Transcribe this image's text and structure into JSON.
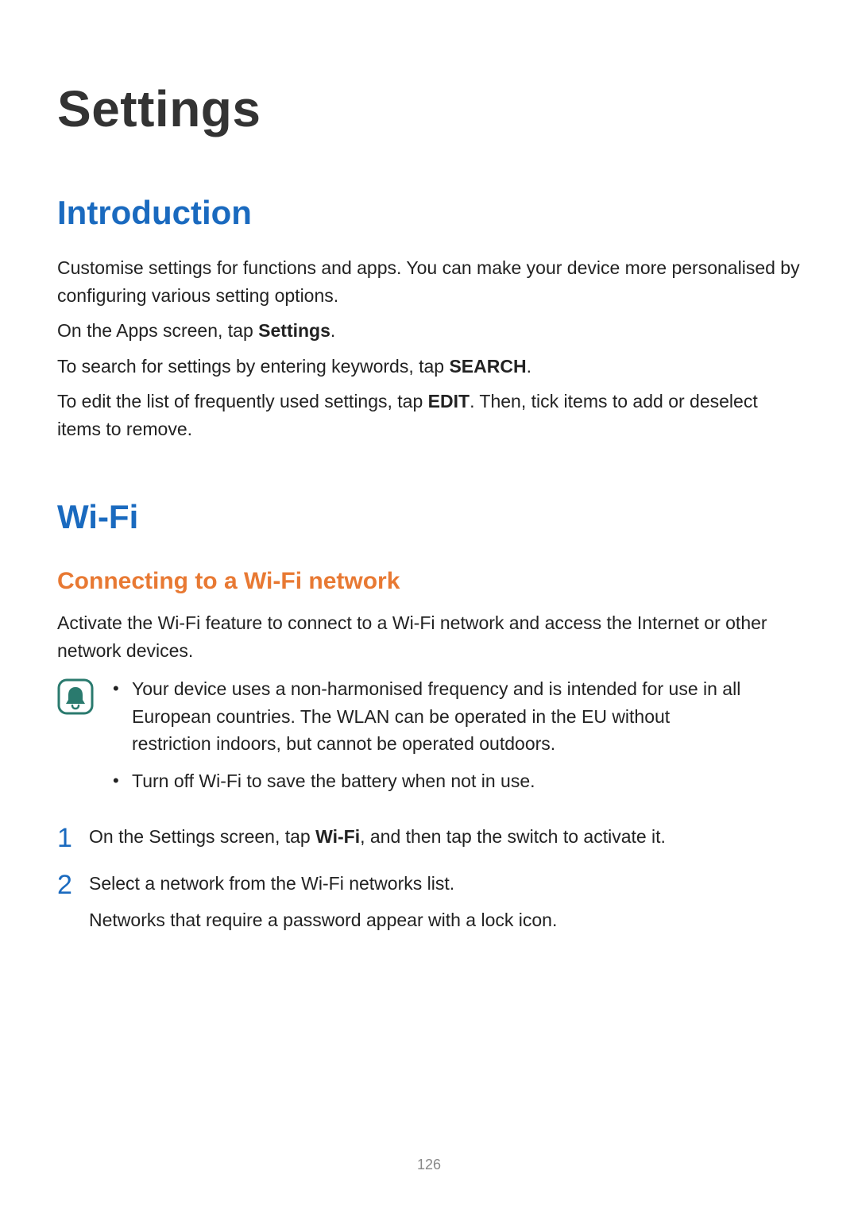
{
  "title": "Settings",
  "pageNumber": "126",
  "introduction": {
    "heading": "Introduction",
    "p1": "Customise settings for functions and apps. You can make your device more personalised by configuring various setting options.",
    "p2_pre": "On the Apps screen, tap ",
    "p2_bold": "Settings",
    "p2_post": ".",
    "p3_pre": "To search for settings by entering keywords, tap ",
    "p3_bold": "SEARCH",
    "p3_post": ".",
    "p4_pre": "To edit the list of frequently used settings, tap ",
    "p4_bold": "EDIT",
    "p4_post": ". Then, tick items to add or deselect items to remove."
  },
  "wifi": {
    "heading": "Wi-Fi",
    "sub1": {
      "heading": "Connecting to a Wi-Fi network",
      "p1": "Activate the Wi-Fi feature to connect to a Wi-Fi network and access the Internet or other network devices.",
      "notes": [
        "Your device uses a non-harmonised frequency and is intended for use in all European countries. The WLAN can be operated in the EU without restriction indoors, but cannot be operated outdoors.",
        "Turn off Wi-Fi to save the battery when not in use."
      ],
      "steps": {
        "s1_pre": "On the Settings screen, tap ",
        "s1_bold": "Wi-Fi",
        "s1_post": ", and then tap the switch to activate it.",
        "s2_main": "Select a network from the Wi-Fi networks list.",
        "s2_sub": "Networks that require a password appear with a lock icon."
      }
    }
  }
}
